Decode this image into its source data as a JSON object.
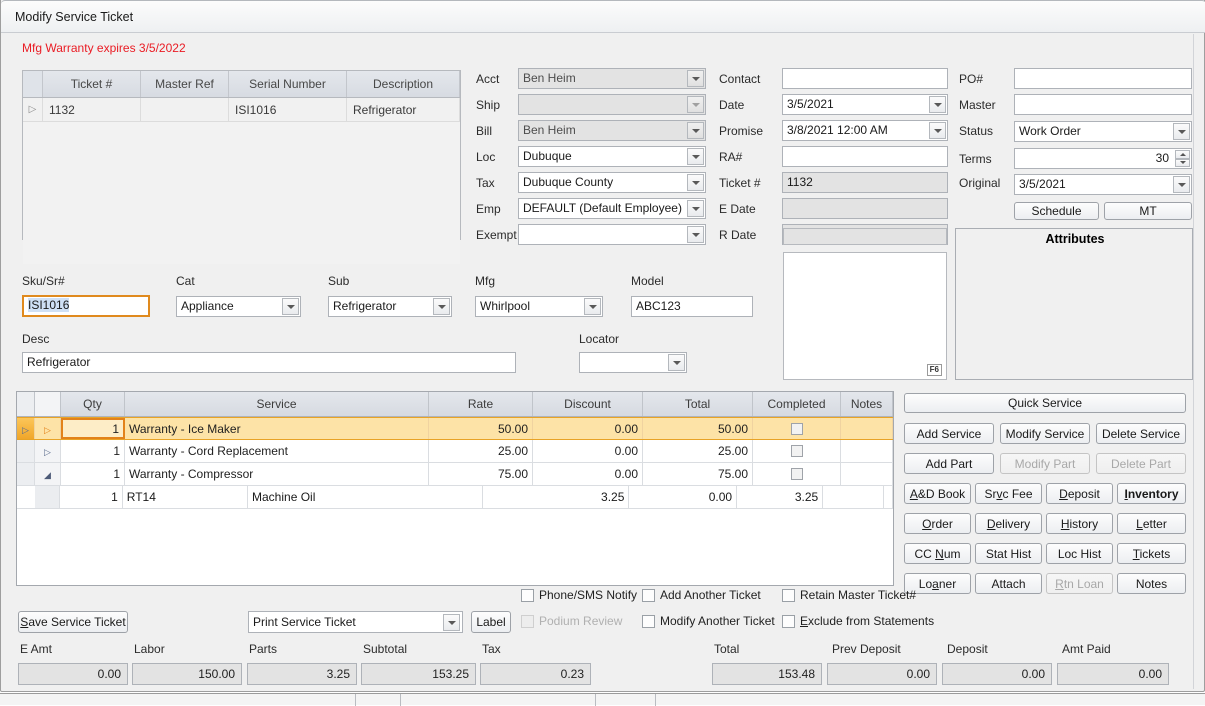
{
  "window": {
    "title": "Modify Service Ticket"
  },
  "warning": "Mfg Warranty expires 3/5/2022",
  "ticket_grid": {
    "columns": [
      "",
      "Ticket #",
      "Master Ref",
      "Serial Number",
      "Description"
    ],
    "rows": [
      {
        "marker": "▷",
        "ticket": "1132",
        "master_ref": "",
        "serial": "ISI1016",
        "description": "Refrigerator"
      }
    ]
  },
  "header_form": {
    "col1": [
      {
        "label": "Acct",
        "value": "Ben Heim",
        "type": "combo",
        "disabled": false
      },
      {
        "label": "Ship",
        "value": "",
        "type": "combo",
        "disabled": true
      },
      {
        "label": "Bill",
        "value": "Ben Heim",
        "type": "combo",
        "disabled": false
      },
      {
        "label": "Loc",
        "value": "Dubuque",
        "type": "combo",
        "disabled": false
      },
      {
        "label": "Tax",
        "value": "Dubuque County",
        "type": "combo",
        "disabled": false
      },
      {
        "label": "Emp",
        "value": "DEFAULT (Default Employee)",
        "type": "combo",
        "disabled": false
      },
      {
        "label": "Exempt",
        "value": "",
        "type": "combo",
        "disabled": false
      }
    ],
    "col2": [
      {
        "label": "Contact",
        "value": "",
        "type": "text"
      },
      {
        "label": "Date",
        "value": "3/5/2021",
        "type": "combo"
      },
      {
        "label": "Promise",
        "value": "3/8/2021 12:00 AM",
        "type": "combo"
      },
      {
        "label": "RA#",
        "value": "",
        "type": "text"
      },
      {
        "label": "Ticket #",
        "value": "1132",
        "type": "readonly"
      },
      {
        "label": "E Date",
        "value": "",
        "type": "readonly"
      },
      {
        "label": "R Date",
        "value": "",
        "type": "readonly"
      }
    ],
    "col3": [
      {
        "label": "PO#",
        "value": "",
        "type": "text"
      },
      {
        "label": "Master",
        "value": "",
        "type": "text"
      },
      {
        "label": "Status",
        "value": "Work Order",
        "type": "combo"
      },
      {
        "label": "Terms",
        "value": "30",
        "type": "spinner"
      },
      {
        "label": "Original",
        "value": "3/5/2021",
        "type": "combo"
      }
    ],
    "buttons": [
      {
        "label": "Schedule"
      },
      {
        "label": "MT"
      }
    ]
  },
  "item_form": {
    "sku_label": "Sku/Sr#",
    "sku_value": "ISI1016",
    "cat_label": "Cat",
    "cat_value": "Appliance",
    "sub_label": "Sub",
    "sub_value": "Refrigerator",
    "mfg_label": "Mfg",
    "mfg_value": "Whirlpool",
    "model_label": "Model",
    "model_value": "ABC123",
    "desc_label": "Desc",
    "desc_value": "Refrigerator",
    "locator_label": "Locator",
    "locator_value": ""
  },
  "attributes_panel": {
    "caption": "Attributes"
  },
  "notes_panel": {
    "hotkey": "F6"
  },
  "service_grid": {
    "columns": [
      "",
      "",
      "Qty",
      "Service",
      "Rate",
      "Discount",
      "Total",
      "Completed",
      "Notes"
    ],
    "rows": [
      {
        "selected": true,
        "expander": "▷",
        "qty": "1",
        "service": "Warranty - Ice Maker",
        "rate": "50.00",
        "discount": "0.00",
        "total": "50.00",
        "completed": false,
        "notes": ""
      },
      {
        "selected": false,
        "expander": "▷",
        "qty": "1",
        "service": "Warranty - Cord Replacement",
        "rate": "25.00",
        "discount": "0.00",
        "total": "25.00",
        "completed": false,
        "notes": ""
      },
      {
        "selected": false,
        "expander": "◢",
        "qty": "1",
        "service": "Warranty - Compressor",
        "rate": "75.00",
        "discount": "0.00",
        "total": "75.00",
        "completed": false,
        "notes": ""
      }
    ],
    "part_row": {
      "qty": "1",
      "sku": "RT14",
      "description": "Machine Oil",
      "rate": "3.25",
      "discount": "0.00",
      "total": "3.25"
    }
  },
  "action_buttons": {
    "quick_service": "Quick Service",
    "rows": [
      [
        {
          "label": "Add Service",
          "disabled": false
        },
        {
          "label": "Modify Service",
          "disabled": false
        },
        {
          "label": "Delete Service",
          "disabled": false
        }
      ],
      [
        {
          "label": "Add Part",
          "disabled": false
        },
        {
          "label": "Modify Part",
          "disabled": true
        },
        {
          "label": "Delete Part",
          "disabled": true
        }
      ]
    ],
    "grid": [
      [
        {
          "label": "A&D Book",
          "accel": "A",
          "bold": false
        },
        {
          "label": "Srvc Fee",
          "accel": "v",
          "bold": false
        },
        {
          "label": "Deposit",
          "accel": "D",
          "bold": false
        },
        {
          "label": "Inventory",
          "accel": "I",
          "bold": true
        }
      ],
      [
        {
          "label": "Order",
          "accel": "O",
          "bold": false
        },
        {
          "label": "Delivery",
          "accel": "D",
          "bold": false
        },
        {
          "label": "History",
          "accel": "H",
          "bold": false
        },
        {
          "label": "Letter",
          "accel": "L",
          "bold": false
        }
      ],
      [
        {
          "label": "CC Num",
          "accel": "N",
          "bold": false
        },
        {
          "label": "Stat Hist",
          "accel": "",
          "bold": false
        },
        {
          "label": "Loc Hist",
          "accel": "",
          "bold": false
        },
        {
          "label": "Tickets",
          "accel": "T",
          "bold": false
        }
      ],
      [
        {
          "label": "Loaner",
          "accel": "a",
          "bold": false
        },
        {
          "label": "Attach",
          "accel": "",
          "bold": false
        },
        {
          "label": "Rtn Loan",
          "accel": "R",
          "bold": false,
          "disabled": true
        },
        {
          "label": "Notes",
          "accel": "",
          "bold": false
        }
      ]
    ]
  },
  "bottom_bar": {
    "save_button": "Save Service Ticket",
    "print_select": "Print Service Ticket",
    "label_button": "Label",
    "checkboxes": [
      {
        "label": "Phone/SMS Notify",
        "checked": false,
        "disabled": false
      },
      {
        "label": "Add Another Ticket",
        "checked": false,
        "disabled": false
      },
      {
        "label": "Retain Master Ticket#",
        "checked": false,
        "disabled": false
      },
      {
        "label": "Podium Review",
        "checked": false,
        "disabled": true
      },
      {
        "label": "Modify Another Ticket",
        "checked": false,
        "disabled": false
      },
      {
        "label": "Exclude from Statements",
        "checked": false,
        "disabled": false
      }
    ]
  },
  "totals": {
    "left": [
      {
        "label": "E Amt",
        "value": "0.00"
      },
      {
        "label": "Labor",
        "value": "150.00"
      },
      {
        "label": "Parts",
        "value": "3.25"
      },
      {
        "label": "Subtotal",
        "value": "153.25"
      },
      {
        "label": "Tax",
        "value": "0.23"
      }
    ],
    "right": [
      {
        "label": "Total",
        "value": "153.48"
      },
      {
        "label": "Prev Deposit",
        "value": "0.00"
      },
      {
        "label": "Deposit",
        "value": "0.00"
      },
      {
        "label": "Amt Paid",
        "value": "0.00"
      }
    ]
  }
}
